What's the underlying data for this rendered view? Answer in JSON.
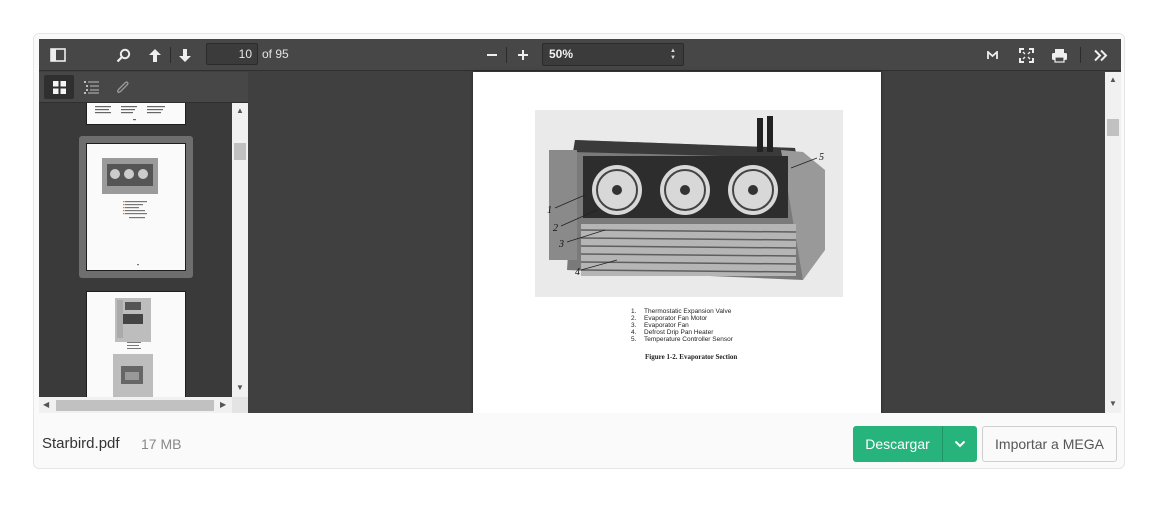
{
  "toolbar": {
    "current_page": "10",
    "page_count": "of 95",
    "zoom": "50%"
  },
  "document_page": {
    "legend": [
      {
        "num": "1.",
        "text": "Thermostatic Expansion Valve"
      },
      {
        "num": "2.",
        "text": "Evaporator Fan Motor"
      },
      {
        "num": "3.",
        "text": "Evaporator Fan"
      },
      {
        "num": "4.",
        "text": "Defrost Drip Pan Heater"
      },
      {
        "num": "5.",
        "text": "Temperature Controller Sensor"
      }
    ],
    "figure_caption": "Figure 1-2. Evaporator Section",
    "callouts": [
      "1",
      "2",
      "3",
      "4",
      "5"
    ]
  },
  "footer": {
    "file_name": "Starbird.pdf",
    "file_size": "17 MB",
    "download_label": "Descargar",
    "import_label": "Importar a MEGA"
  },
  "colors": {
    "accent_green": "#26b37c",
    "toolbar_bg": "#474747",
    "viewer_bg": "#404040"
  },
  "icons": {
    "sidebar_toggle": "sidebar-toggle-icon",
    "search": "search-icon",
    "previous_page": "arrow-up-icon",
    "next_page": "arrow-down-icon",
    "zoom_out": "minus-icon",
    "zoom_in": "plus-icon",
    "presentation": "mega-m-icon",
    "fullscreen": "fullscreen-icon",
    "print": "printer-icon",
    "tools": "double-chevron-right-icon",
    "thumbnails": "grid-icon",
    "outline": "list-icon",
    "attachments": "paperclip-icon",
    "download_options": "chevron-down-icon"
  }
}
